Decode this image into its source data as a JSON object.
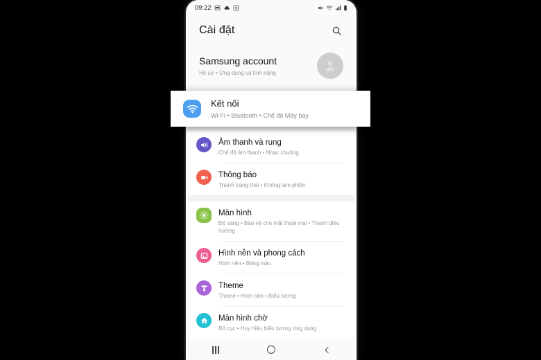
{
  "statusbar": {
    "time": "09:22",
    "left_icons": [
      "sd-card-icon",
      "cloud-icon",
      "screenshot-icon"
    ],
    "right_icons": [
      "mute-icon",
      "wifi-icon",
      "signal-icon",
      "battery-icon"
    ]
  },
  "header": {
    "title": "Cài đặt",
    "search_icon": "search-icon"
  },
  "account": {
    "title": "Samsung account",
    "subtitle": "Hồ sơ • Ứng dụng và tính năng",
    "avatar_icon": "person-icon"
  },
  "highlight": {
    "title": "Kết nối",
    "subtitle": "Wi-Fi • Bluetooth • Chế độ Máy bay",
    "icon": "wifi-icon",
    "icon_color": "#4b9ef0"
  },
  "groups": [
    {
      "items": [
        {
          "title": "Âm thanh và rung",
          "subtitle": "Chế độ âm thanh • Nhạc chuông",
          "icon": "speaker-icon",
          "icon_color": "#6357c8",
          "shape": "circle"
        },
        {
          "title": "Thông báo",
          "subtitle": "Thanh trạng thái • Không làm phiền",
          "icon": "notification-icon",
          "icon_color": "#f0614f",
          "shape": "circle"
        }
      ]
    },
    {
      "items": [
        {
          "title": "Màn hình",
          "subtitle": "Độ sáng • Bảo vệ cho mắt thoải mái • Thanh điều hướng",
          "icon": "brightness-icon",
          "icon_color": "#8bc34a",
          "shape": "rounded"
        },
        {
          "title": "Hình nền và phong cách",
          "subtitle": "Hình nền • Bảng màu",
          "icon": "wallpaper-icon",
          "icon_color": "#ed5f92",
          "shape": "circle"
        },
        {
          "title": "Theme",
          "subtitle": "Theme • Hình nền • Biểu tượng",
          "icon": "theme-icon",
          "icon_color": "#a964d8",
          "shape": "circle"
        },
        {
          "title": "Màn hình chờ",
          "subtitle": "Bố cục • Huy hiệu biểu tượng ứng dụng",
          "icon": "home-screen-icon",
          "icon_color": "#21c1d6",
          "shape": "circle"
        }
      ]
    }
  ],
  "navbar": {
    "recents_label": "recents-button",
    "home_label": "home-button",
    "back_label": "back-button"
  }
}
